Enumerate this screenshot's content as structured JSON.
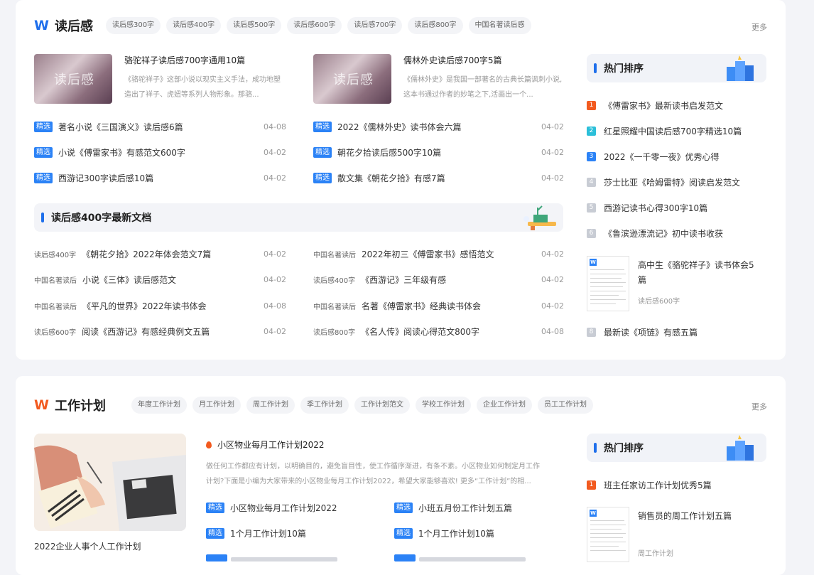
{
  "section1": {
    "title": "读后感",
    "tags": [
      "读后感300字",
      "读后感400字",
      "读后感500字",
      "读后感600字",
      "读后感700字",
      "读后感800字",
      "中国名著读后感"
    ],
    "more": "更多",
    "thumb_text": "读后感",
    "featured": [
      {
        "title": "骆驼祥子读后感700字通用10篇",
        "desc": "《骆驼祥子》这部小说以现实主义手法，成功地塑造出了祥子、虎妞等系列人物形象。那骆..."
      },
      {
        "title": "儒林外史读后感700字5篇",
        "desc": "《儒林外史》是我国一部著名的古典长篇讽刺小说,这本书通过作者的妙笔之下,活画出一个..."
      }
    ],
    "badge": "精选",
    "left_list": [
      {
        "title": "著名小说《三国演义》读后感6篇",
        "date": "04-08"
      },
      {
        "title": "小说《傅雷家书》有感范文600字",
        "date": "04-02"
      },
      {
        "title": "西游记300字读后感10篇",
        "date": "04-02"
      }
    ],
    "right_list": [
      {
        "title": "2022《儒林外史》读书体会六篇",
        "date": "04-02"
      },
      {
        "title": "朝花夕拾读后感500字10篇",
        "date": "04-02"
      },
      {
        "title": "散文集《朝花夕拾》有感7篇",
        "date": "04-02"
      }
    ],
    "sub_title": "读后感400字最新文档",
    "latest_left": [
      {
        "cat": "读后感400字",
        "title": "《朝花夕拾》2022年体会范文7篇",
        "date": "04-02"
      },
      {
        "cat": "中国名著读后",
        "title": "小说《三体》读后感范文",
        "date": "04-02"
      },
      {
        "cat": "中国名著读后",
        "title": "《平凡的世界》2022年读书体会",
        "date": "04-08"
      },
      {
        "cat": "读后感600字",
        "title": "阅读《西游记》有感经典例文五篇",
        "date": "04-02"
      }
    ],
    "latest_right": [
      {
        "cat": "中国名著读后",
        "title": "2022年初三《傅雷家书》感悟范文",
        "date": "04-02"
      },
      {
        "cat": "读后感400字",
        "title": "《西游记》三年级有感",
        "date": "04-02"
      },
      {
        "cat": "中国名著读后",
        "title": "名著《傅雷家书》经典读书体会",
        "date": "04-02"
      },
      {
        "cat": "读后感800字",
        "title": "《名人传》阅读心得范文800字",
        "date": "04-08"
      }
    ],
    "hot": {
      "title": "热门排序",
      "items": [
        {
          "n": "1",
          "title": "《傅雷家书》最新读书启发范文"
        },
        {
          "n": "2",
          "title": "红星照耀中国读后感700字精选10篇"
        },
        {
          "n": "3",
          "title": "2022《一千零一夜》优秀心得"
        },
        {
          "n": "4",
          "title": "莎士比亚《哈姆雷特》阅读启发范文"
        },
        {
          "n": "5",
          "title": "西游记读书心得300字10篇"
        },
        {
          "n": "6",
          "title": "《鲁滨逊漂流记》初中读书收获"
        },
        {
          "n": "8",
          "title": "最新读《项链》有感五篇"
        }
      ],
      "doc_title_1": "高中生《骆驼祥子》读书体会5",
      "doc_title_2": "篇",
      "doc_cat": "读后感600字"
    }
  },
  "section2": {
    "title": "工作计划",
    "tags": [
      "年度工作计划",
      "月工作计划",
      "周工作计划",
      "季工作计划",
      "工作计划范文",
      "学校工作计划",
      "企业工作计划",
      "员工工作计划"
    ],
    "more": "更多",
    "illus_caption": "2022企业人事个人工作计划",
    "featured_title": "小区物业每月工作计划2022",
    "featured_desc_1": "做任何工作都应有计划，以明确目的，避免盲目性，使工作循序渐进，有条不紊。小区物业如何制定月工作",
    "featured_desc_2": "计划?下面是小编为大家带来的小区物业每月工作计划2022，希望大家能够喜欢! 更多“工作计划”的相...",
    "badge": "精选",
    "list_left": [
      "小区物业每月工作计划2022",
      "1个月工作计划10篇"
    ],
    "list_right": [
      "小班五月份工作计划五篇",
      "1个月工作计划10篇"
    ],
    "hot": {
      "title": "热门排序",
      "items": [
        {
          "n": "1",
          "title": "班主任家访工作计划优秀5篇"
        }
      ],
      "doc_title": "销售员的周工作计划五篇",
      "doc_cat": "周工作计划"
    }
  }
}
